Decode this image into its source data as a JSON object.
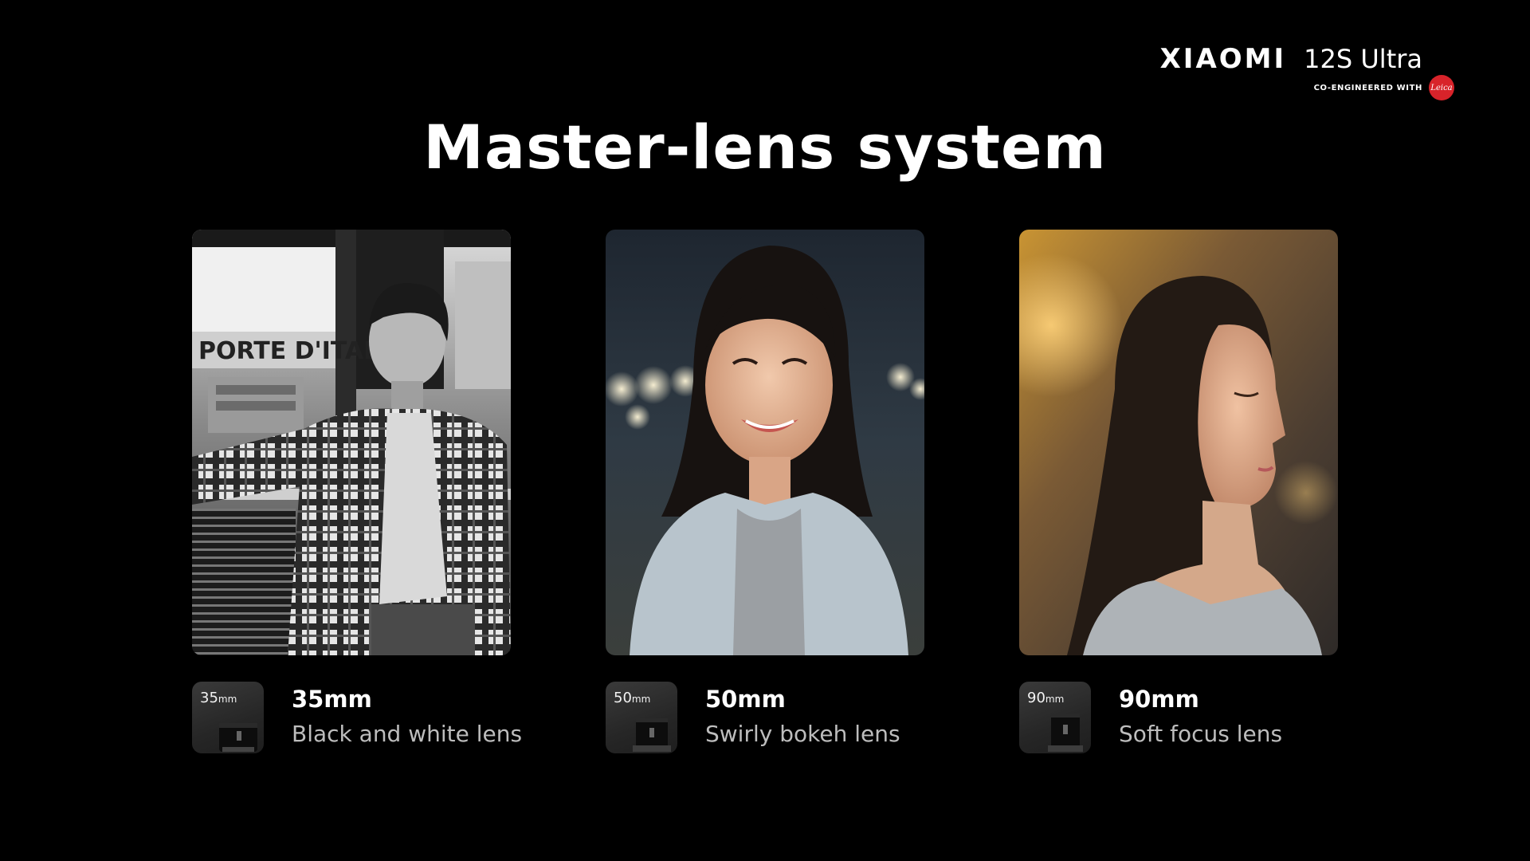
{
  "brand": {
    "name": "XIAOMI",
    "model": "12S Ultra",
    "co_engineered": "CO-ENGINEERED WITH",
    "partner_logo": "Leica"
  },
  "title": "Master-lens system",
  "lenses": [
    {
      "tile_value": "35",
      "tile_unit": "mm",
      "name": "35mm",
      "description": "Black and white lens",
      "photo": "black-and-white portrait of a man in a plaid shirt seated on a train"
    },
    {
      "tile_value": "50",
      "tile_unit": "mm",
      "name": "50mm",
      "description": "Swirly bokeh lens",
      "photo": "smiling woman at night with bokeh city lights"
    },
    {
      "tile_value": "90",
      "tile_unit": "mm",
      "name": "90mm",
      "description": "Soft focus lens",
      "photo": "soft focus profile of a woman with warm golden background"
    }
  ],
  "colors": {
    "background": "#000000",
    "leica_red": "#d8232a",
    "description_text": "#bdbdbd"
  }
}
